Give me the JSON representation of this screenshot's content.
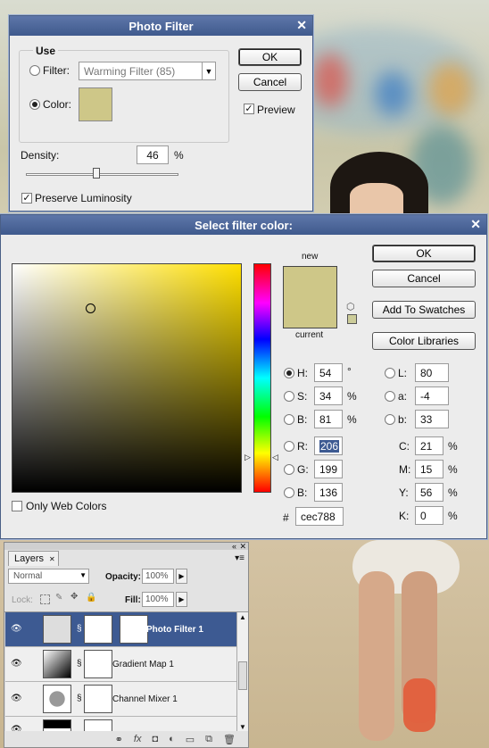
{
  "photo_filter": {
    "title": "Photo Filter",
    "use_label": "Use",
    "filter_label": "Filter:",
    "filter_value": "Warming Filter (85)",
    "color_label": "Color:",
    "color_swatch": "#cec788",
    "density_label": "Density:",
    "density_value": "46",
    "density_unit": "%",
    "density_fraction": 0.46,
    "preserve_label": "Preserve Luminosity",
    "ok_label": "OK",
    "cancel_label": "Cancel",
    "preview_label": "Preview"
  },
  "color_picker": {
    "title": "Select filter color:",
    "new_label": "new",
    "current_label": "current",
    "new_color": "#cec788",
    "ok_label": "OK",
    "cancel_label": "Cancel",
    "swatches_label": "Add To Swatches",
    "libraries_label": "Color Libraries",
    "only_web_label": "Only Web Colors",
    "fields": {
      "H": {
        "label": "H:",
        "value": "54",
        "unit": "°"
      },
      "S": {
        "label": "S:",
        "value": "34",
        "unit": "%"
      },
      "Bv": {
        "label": "B:",
        "value": "81",
        "unit": "%"
      },
      "R": {
        "label": "R:",
        "value": "206"
      },
      "G": {
        "label": "G:",
        "value": "199"
      },
      "Bl": {
        "label": "B:",
        "value": "136"
      },
      "L": {
        "label": "L:",
        "value": "80"
      },
      "a": {
        "label": "a:",
        "value": "-4"
      },
      "b": {
        "label": "b:",
        "value": "33"
      },
      "C": {
        "label": "C:",
        "value": "21",
        "unit": "%"
      },
      "M": {
        "label": "M:",
        "value": "15",
        "unit": "%"
      },
      "Y": {
        "label": "Y:",
        "value": "56",
        "unit": "%"
      },
      "K": {
        "label": "K:",
        "value": "0",
        "unit": "%"
      },
      "hex_label": "#",
      "hex": "cec788"
    }
  },
  "layers": {
    "tab_label": "Layers",
    "blend_mode": "Normal",
    "opacity_label": "Opacity:",
    "opacity_value": "100%",
    "lock_label": "Lock:",
    "fill_label": "Fill:",
    "fill_value": "100%",
    "items": [
      {
        "name": "Photo Filter 1"
      },
      {
        "name": "Gradient Map 1"
      },
      {
        "name": "Channel Mixer 1"
      }
    ]
  }
}
